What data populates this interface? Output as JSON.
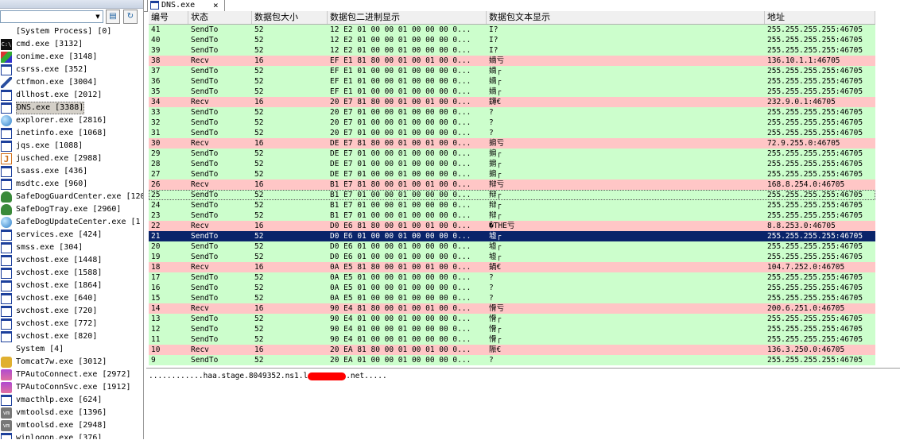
{
  "left_panel": {
    "processes": [
      {
        "name": "[System Process] [0]",
        "icon": "none"
      },
      {
        "name": "cmd.exe [3132]",
        "icon": "cmd"
      },
      {
        "name": "conime.exe [3148]",
        "icon": "color"
      },
      {
        "name": "csrss.exe [352]",
        "icon": "window"
      },
      {
        "name": "ctfmon.exe [3004]",
        "icon": "pen"
      },
      {
        "name": "dllhost.exe [2012]",
        "icon": "window"
      },
      {
        "name": "DNS.exe [3388]",
        "icon": "window",
        "selected": true
      },
      {
        "name": "explorer.exe [2816]",
        "icon": "globe"
      },
      {
        "name": "inetinfo.exe [1068]",
        "icon": "window"
      },
      {
        "name": "jqs.exe [1088]",
        "icon": "window"
      },
      {
        "name": "jusched.exe [2988]",
        "icon": "java"
      },
      {
        "name": "lsass.exe [436]",
        "icon": "window"
      },
      {
        "name": "msdtc.exe [960]",
        "icon": "window"
      },
      {
        "name": "SafeDogGuardCenter.exe [120",
        "icon": "shield"
      },
      {
        "name": "SafeDogTray.exe [2960]",
        "icon": "shield"
      },
      {
        "name": "SafeDogUpdateCenter.exe [1",
        "icon": "globe"
      },
      {
        "name": "services.exe [424]",
        "icon": "window"
      },
      {
        "name": "smss.exe [304]",
        "icon": "window"
      },
      {
        "name": "svchost.exe [1448]",
        "icon": "window"
      },
      {
        "name": "svchost.exe [1588]",
        "icon": "window"
      },
      {
        "name": "svchost.exe [1864]",
        "icon": "window"
      },
      {
        "name": "svchost.exe [640]",
        "icon": "window"
      },
      {
        "name": "svchost.exe [720]",
        "icon": "window"
      },
      {
        "name": "svchost.exe [772]",
        "icon": "window"
      },
      {
        "name": "svchost.exe [820]",
        "icon": "window"
      },
      {
        "name": "System [4]",
        "icon": "none"
      },
      {
        "name": "Tomcat7w.exe [3012]",
        "icon": "tomcat"
      },
      {
        "name": "TPAutoConnect.exe [2972]",
        "icon": "tp"
      },
      {
        "name": "TPAutoConnSvc.exe [1912]",
        "icon": "tp"
      },
      {
        "name": "vmacthlp.exe [624]",
        "icon": "window"
      },
      {
        "name": "vmtoolsd.exe [1396]",
        "icon": "vm"
      },
      {
        "name": "vmtoolsd.exe [2948]",
        "icon": "vm"
      },
      {
        "name": "winlogon.exe [376]",
        "icon": "window"
      }
    ]
  },
  "tab": {
    "label": "DNS.exe",
    "close": "×"
  },
  "columns": [
    "编号",
    "状态",
    "数据包大小",
    "数据包二进制显示",
    "数据包文本显示",
    "地址"
  ],
  "rows": [
    {
      "no": "41",
      "status": "SendTo",
      "size": "52",
      "hex": "12 E2 01 00 00 01 00 00 00 0...",
      "text": "I?",
      "addr": "255.255.255.255:46705"
    },
    {
      "no": "40",
      "status": "SendTo",
      "size": "52",
      "hex": "12 E2 01 00 00 01 00 00 00 0...",
      "text": "I?",
      "addr": "255.255.255.255:46705"
    },
    {
      "no": "39",
      "status": "SendTo",
      "size": "52",
      "hex": "12 E2 01 00 00 01 00 00 00 0...",
      "text": "I?",
      "addr": "255.255.255.255:46705"
    },
    {
      "no": "38",
      "status": "Recv",
      "size": "16",
      "hex": "EF E1 81 80 00 01 00 01 00 0...",
      "text": "嫡亏",
      "addr": "136.10.1.1:46705"
    },
    {
      "no": "37",
      "status": "SendTo",
      "size": "52",
      "hex": "EF E1 01 00 00 01 00 00 00 0...",
      "text": "嫡┌",
      "addr": "255.255.255.255:46705"
    },
    {
      "no": "36",
      "status": "SendTo",
      "size": "52",
      "hex": "EF E1 01 00 00 01 00 00 00 0...",
      "text": "嫡┌",
      "addr": "255.255.255.255:46705"
    },
    {
      "no": "35",
      "status": "SendTo",
      "size": "52",
      "hex": "EF E1 01 00 00 01 00 00 00 0...",
      "text": "嫡┌",
      "addr": "255.255.255.255:46705"
    },
    {
      "no": "34",
      "status": "Recv",
      "size": "16",
      "hex": "20 E7 81 80 00 01 00 01 00 0...",
      "text": " 鑮€",
      "addr": "232.9.0.1:46705"
    },
    {
      "no": "33",
      "status": "SendTo",
      "size": "52",
      "hex": "20 E7 01 00 00 01 00 00 00 0...",
      "text": " ?",
      "addr": "255.255.255.255:46705"
    },
    {
      "no": "32",
      "status": "SendTo",
      "size": "52",
      "hex": "20 E7 01 00 00 01 00 00 00 0...",
      "text": " ?",
      "addr": "255.255.255.255:46705"
    },
    {
      "no": "31",
      "status": "SendTo",
      "size": "52",
      "hex": "20 E7 01 00 00 01 00 00 00 0...",
      "text": " ?",
      "addr": "255.255.255.255:46705"
    },
    {
      "no": "30",
      "status": "Recv",
      "size": "16",
      "hex": "DE E7 81 80 00 01 00 01 00 0...",
      "text": "掮亏",
      "addr": "72.9.255.0:46705"
    },
    {
      "no": "29",
      "status": "SendTo",
      "size": "52",
      "hex": "DE E7 01 00 00 01 00 00 00 0...",
      "text": "掮┌",
      "addr": "255.255.255.255:46705"
    },
    {
      "no": "28",
      "status": "SendTo",
      "size": "52",
      "hex": "DE E7 01 00 00 01 00 00 00 0...",
      "text": "掮┌",
      "addr": "255.255.255.255:46705"
    },
    {
      "no": "27",
      "status": "SendTo",
      "size": "52",
      "hex": "DE E7 01 00 00 01 00 00 00 0...",
      "text": "掮┌",
      "addr": "255.255.255.255:46705"
    },
    {
      "no": "26",
      "status": "Recv",
      "size": "16",
      "hex": "B1 E7 81 80 00 01 00 01 00 0...",
      "text": "辩亏",
      "addr": "168.8.254.0:46705"
    },
    {
      "no": "25",
      "status": "SendTo",
      "size": "52",
      "hex": "B1 E7 01 00 00 01 00 00 00 0...",
      "text": "辩┌",
      "addr": "255.255.255.255:46705",
      "focus": true
    },
    {
      "no": "24",
      "status": "SendTo",
      "size": "52",
      "hex": "B1 E7 01 00 00 01 00 00 00 0...",
      "text": "辩┌",
      "addr": "255.255.255.255:46705"
    },
    {
      "no": "23",
      "status": "SendTo",
      "size": "52",
      "hex": "B1 E7 01 00 00 01 00 00 00 0...",
      "text": "辩┌",
      "addr": "255.255.255.255:46705"
    },
    {
      "no": "22",
      "status": "Recv",
      "size": "16",
      "hex": "D0 E6 81 80 00 01 00 01 00 0...",
      "text": "�THE亏",
      "addr": "8.8.253.0:46705"
    },
    {
      "no": "21",
      "status": "SendTo",
      "size": "52",
      "hex": "D0 E6 01 00 00 01 00 00 00 0...",
      "text": "墟┌",
      "addr": "255.255.255.255:46705",
      "selected": true
    },
    {
      "no": "20",
      "status": "SendTo",
      "size": "52",
      "hex": "D0 E6 01 00 00 01 00 00 00 0...",
      "text": "墟┌",
      "addr": "255.255.255.255:46705"
    },
    {
      "no": "19",
      "status": "SendTo",
      "size": "52",
      "hex": "D0 E6 01 00 00 01 00 00 00 0...",
      "text": "墟┌",
      "addr": "255.255.255.255:46705"
    },
    {
      "no": "18",
      "status": "Recv",
      "size": "16",
      "hex": "0A E5 81 80 00 01 00 01 00 0...",
      "text": "\n鍋€",
      "addr": "104.7.252.0:46705"
    },
    {
      "no": "17",
      "status": "SendTo",
      "size": "52",
      "hex": "0A E5 01 00 00 01 00 00 00 0...",
      "text": "\n?",
      "addr": "255.255.255.255:46705"
    },
    {
      "no": "16",
      "status": "SendTo",
      "size": "52",
      "hex": "0A E5 01 00 00 01 00 00 00 0...",
      "text": "\n?",
      "addr": "255.255.255.255:46705"
    },
    {
      "no": "15",
      "status": "SendTo",
      "size": "52",
      "hex": "0A E5 01 00 00 01 00 00 00 0...",
      "text": "\n?",
      "addr": "255.255.255.255:46705"
    },
    {
      "no": "14",
      "status": "Recv",
      "size": "16",
      "hex": "90 E4 81 80 00 01 00 01 00 0...",
      "text": "愲亏",
      "addr": "200.6.251.0:46705"
    },
    {
      "no": "13",
      "status": "SendTo",
      "size": "52",
      "hex": "90 E4 01 00 00 01 00 00 00 0...",
      "text": "愲┌",
      "addr": "255.255.255.255:46705"
    },
    {
      "no": "12",
      "status": "SendTo",
      "size": "52",
      "hex": "90 E4 01 00 00 01 00 00 00 0...",
      "text": "愲┌",
      "addr": "255.255.255.255:46705"
    },
    {
      "no": "11",
      "status": "SendTo",
      "size": "52",
      "hex": "90 E4 01 00 00 01 00 00 00 0...",
      "text": "愲┌",
      "addr": "255.255.255.255:46705"
    },
    {
      "no": "10",
      "status": "Recv",
      "size": "16",
      "hex": "20 EA 81 80 00 01 00 01 00 0...",
      "text": " 陙€",
      "addr": "136.3.250.0:46705"
    },
    {
      "no": "9",
      "status": "SendTo",
      "size": "52",
      "hex": "20 EA 01 00 00 01 00 00 00 0...",
      "text": " ?",
      "addr": "255.255.255.255:46705"
    }
  ],
  "bottom": {
    "dump_prefix": "............haa.stage.8049352.ns1.l",
    "dump_suffix": ".net....."
  }
}
